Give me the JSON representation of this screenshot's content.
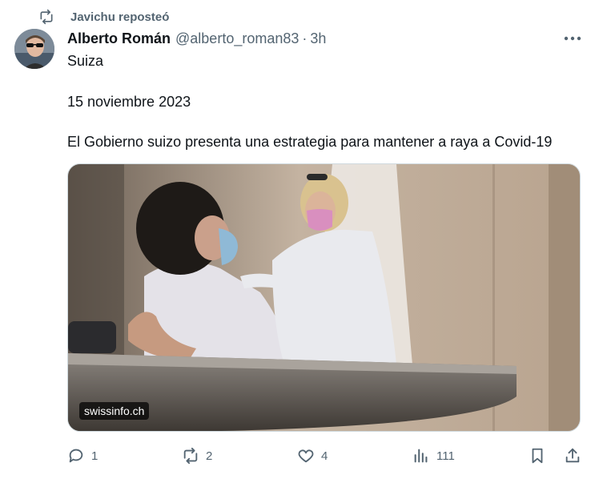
{
  "repost": {
    "text": "Javichu reposteó",
    "icon": "repost-icon"
  },
  "author": {
    "name": "Alberto Román",
    "handle": "@alberto_roman83",
    "separator": "·",
    "time": "3h"
  },
  "tweet": {
    "lines": [
      "Suiza",
      "15 noviembre 2023",
      "El Gobierno suizo presenta una estrategia para mantener a raya a Covid-19"
    ]
  },
  "media": {
    "source": "swissinfo.ch"
  },
  "actions": {
    "reply": {
      "icon": "reply-icon",
      "count": "1"
    },
    "repost": {
      "icon": "repost-icon",
      "count": "2"
    },
    "like": {
      "icon": "heart-icon",
      "count": "4"
    },
    "views": {
      "icon": "views-icon",
      "count": "111"
    },
    "bookmark": {
      "icon": "bookmark-icon"
    },
    "share": {
      "icon": "share-icon"
    }
  },
  "colors": {
    "text": "#0f1419",
    "secondary": "#536471",
    "border": "#cfd9de"
  }
}
